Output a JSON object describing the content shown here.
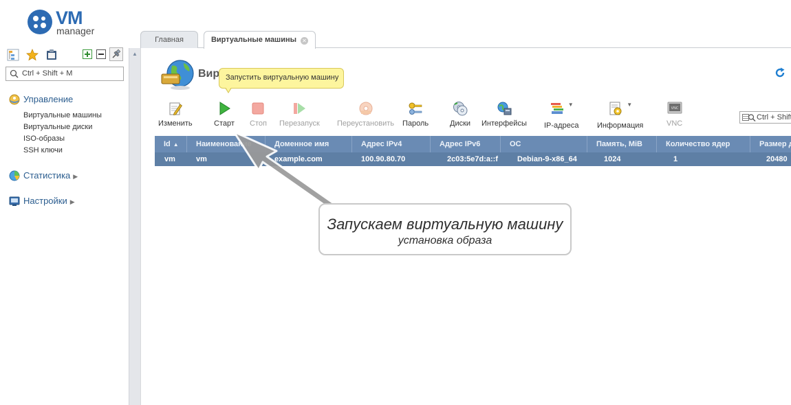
{
  "logo": {
    "brand": "VM",
    "product": "manager"
  },
  "sidebar": {
    "search_label": "Ctrl + Shift + M",
    "sections": [
      {
        "title": "Управление",
        "icon": "management-icon",
        "items": [
          "Виртуальные машины",
          "Виртуальные диски",
          "ISO-образы",
          "SSH ключи"
        ]
      },
      {
        "title": "Статистика",
        "icon": "statistics-icon",
        "items": []
      },
      {
        "title": "Настройки",
        "icon": "settings-icon",
        "items": []
      }
    ]
  },
  "tabs": [
    {
      "label": "Главная",
      "active": false
    },
    {
      "label": "Виртуальные машины",
      "active": true,
      "closable": true
    }
  ],
  "page": {
    "title": "Вир"
  },
  "tooltip": "Запустить виртуальную машину",
  "toolbar": {
    "buttons": [
      {
        "label": "Изменить",
        "icon": "edit-icon",
        "enabled": true
      },
      {
        "label": "Старт",
        "icon": "play-icon",
        "enabled": true
      },
      {
        "label": "Стоп",
        "icon": "stop-icon",
        "enabled": false
      },
      {
        "label": "Перезапуск",
        "icon": "restart-icon",
        "enabled": false
      },
      {
        "label": "Переустановить",
        "icon": "reinstall-icon",
        "enabled": false
      },
      {
        "label": "Пароль",
        "icon": "key-icon",
        "enabled": true
      },
      {
        "label": "Диски",
        "icon": "disks-icon",
        "enabled": true
      },
      {
        "label": "Интерфейсы",
        "icon": "interfaces-icon",
        "enabled": true
      },
      {
        "label": "IP-адреса",
        "icon": "ip-addresses-icon",
        "enabled": true,
        "dropdown": true
      },
      {
        "label": "Информация",
        "icon": "info-icon",
        "enabled": true,
        "dropdown": true
      },
      {
        "label": "VNC",
        "icon": "vnc-icon",
        "enabled": false
      }
    ],
    "search_label": "Ctrl + Shift"
  },
  "table": {
    "columns": [
      "Id",
      "Наименование",
      "Доменное имя",
      "Адрес IPv4",
      "Адрес IPv6",
      "ОС",
      "Память, MiB",
      "Количество ядер",
      "Размер д"
    ],
    "sorted_column": "Id",
    "rows": [
      [
        "vm",
        "vm",
        "example.com",
        "100.90.80.70",
        "2c03:5e7d:a::f",
        "Debian-9-x86_64",
        "1024",
        "1",
        "20480"
      ]
    ]
  },
  "annotation": {
    "line1": "Запускаем виртуальную машину",
    "line2": "установка образа"
  },
  "colors": {
    "accent": "#2d6bb3",
    "table_header": "#6a8bb4",
    "selected_row": "#5e7fa5",
    "tooltip_bg": "#fdf59e"
  }
}
